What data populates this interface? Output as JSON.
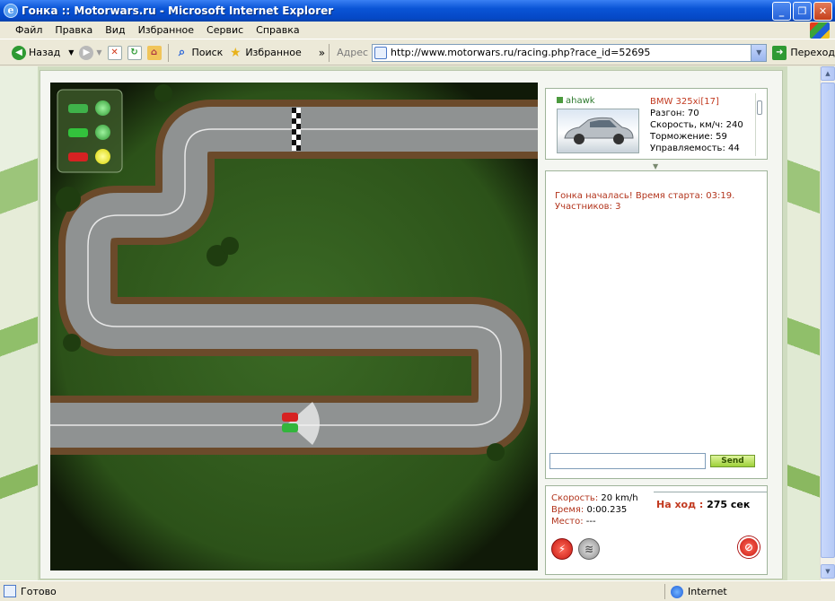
{
  "window": {
    "title": "Гонка :: Motorwars.ru - Microsoft Internet Explorer",
    "app_icon": "ie-icon",
    "controls": [
      "minimize",
      "maximize",
      "close"
    ]
  },
  "menu": {
    "items": [
      "Файл",
      "Правка",
      "Вид",
      "Избранное",
      "Сервис",
      "Справка"
    ]
  },
  "toolbar": {
    "back_label": "Назад",
    "search_label": "Поиск",
    "favorites_label": "Избранное",
    "more": "»",
    "address_label": "Адрес",
    "address_value": "http://www.motorwars.ru/racing.php?race_id=52695",
    "go_label": "Переход"
  },
  "race": {
    "lights": [
      {
        "car_color": "#3fb24a",
        "light": "green"
      },
      {
        "car_color": "#33c23c",
        "light": "green"
      },
      {
        "car_color": "#d62222",
        "light": "yellow"
      }
    ]
  },
  "car_card": {
    "username": "ahawk",
    "model": "BMW 325xi[17]",
    "stats": [
      "Разгон: 70",
      "Скорость, км/ч: 240",
      "Торможение: 59",
      "Управляемость: 44"
    ]
  },
  "chat": {
    "messages": [
      "Гонка началась! Время старта: 03:19.",
      "Участников: 3"
    ],
    "input_value": "",
    "send_label": "Send"
  },
  "status": {
    "speed_label": "Скорость:",
    "speed_value": "20 km/h",
    "time_label": "Время:",
    "time_value": "0:00.235",
    "place_label": "Место:",
    "place_value": "---",
    "turn_label": "На ход :",
    "turn_value": "275 сек"
  },
  "statusbar": {
    "text": "Готово",
    "zone": "Internet"
  },
  "colors": {
    "title_blue": "#0a54d6",
    "accent_red": "#c23a20",
    "grass": "#2f5a1c",
    "asphalt": "#8a8d8d"
  }
}
